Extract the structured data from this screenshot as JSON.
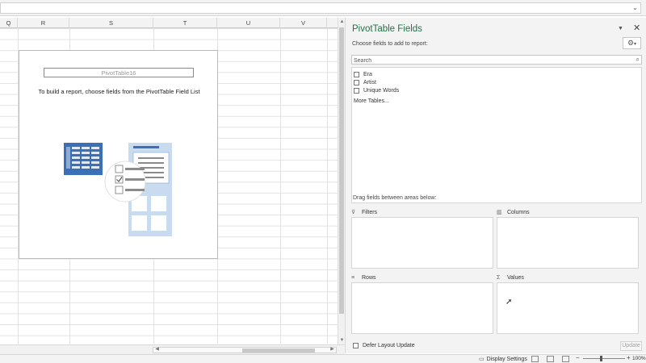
{
  "columns": [
    "Q",
    "R",
    "S",
    "T",
    "U",
    "V"
  ],
  "pivot": {
    "name": "PivotTable16",
    "instruction": "To build a report, choose fields from the PivotTable Field List"
  },
  "pane": {
    "title": "PivotTable Fields",
    "choose_label": "Choose fields to add to report:",
    "search_placeholder": "Search",
    "fields": [
      {
        "label": "Era",
        "checked": false
      },
      {
        "label": "Artist",
        "checked": false
      },
      {
        "label": "Unique Words",
        "checked": false
      }
    ],
    "more_tables": "More Tables...",
    "drag_label": "Drag fields between areas below:",
    "areas": {
      "filters": "Filters",
      "columns": "Columns",
      "rows": "Rows",
      "values": "Values"
    },
    "defer_label": "Defer Layout Update",
    "update_label": "Update"
  },
  "status": {
    "display_settings": "Display Settings",
    "zoom": "100%"
  },
  "colors": {
    "pane_title": "#217346",
    "illustration_blue": "#3b6fb6",
    "illustration_light": "#c9dbef"
  }
}
